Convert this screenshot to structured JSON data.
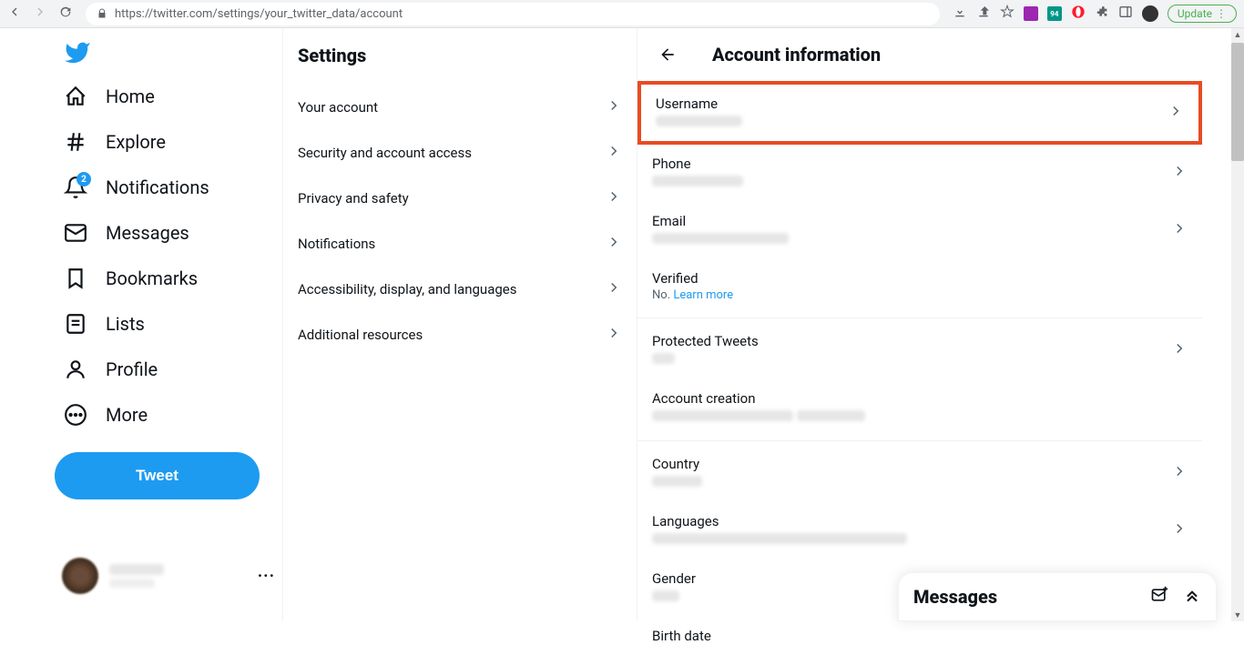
{
  "browser": {
    "url": "https://twitter.com/settings/your_twitter_data/account",
    "update_label": "Update",
    "ext_badge": "94"
  },
  "nav": {
    "notifications_badge": "2",
    "items": [
      {
        "label": "Home"
      },
      {
        "label": "Explore"
      },
      {
        "label": "Notifications"
      },
      {
        "label": "Messages"
      },
      {
        "label": "Bookmarks"
      },
      {
        "label": "Lists"
      },
      {
        "label": "Profile"
      },
      {
        "label": "More"
      }
    ],
    "tweet_label": "Tweet"
  },
  "settings": {
    "title": "Settings",
    "items": [
      {
        "label": "Your account"
      },
      {
        "label": "Security and account access"
      },
      {
        "label": "Privacy and safety"
      },
      {
        "label": "Notifications"
      },
      {
        "label": "Accessibility, display, and languages"
      },
      {
        "label": "Additional resources"
      }
    ]
  },
  "detail": {
    "title": "Account information",
    "info": [
      {
        "label": "Username"
      },
      {
        "label": "Phone"
      },
      {
        "label": "Email"
      },
      {
        "label": "Verified",
        "value_prefix": "No. ",
        "link_text": "Learn more"
      },
      {
        "label": "Protected Tweets"
      },
      {
        "label": "Account creation"
      },
      {
        "label": "Country"
      },
      {
        "label": "Languages"
      },
      {
        "label": "Gender"
      },
      {
        "label": "Birth date"
      }
    ]
  },
  "messages_drawer": {
    "title": "Messages"
  },
  "colors": {
    "accent": "#1d9bf0",
    "highlight_border": "#e74c23"
  }
}
